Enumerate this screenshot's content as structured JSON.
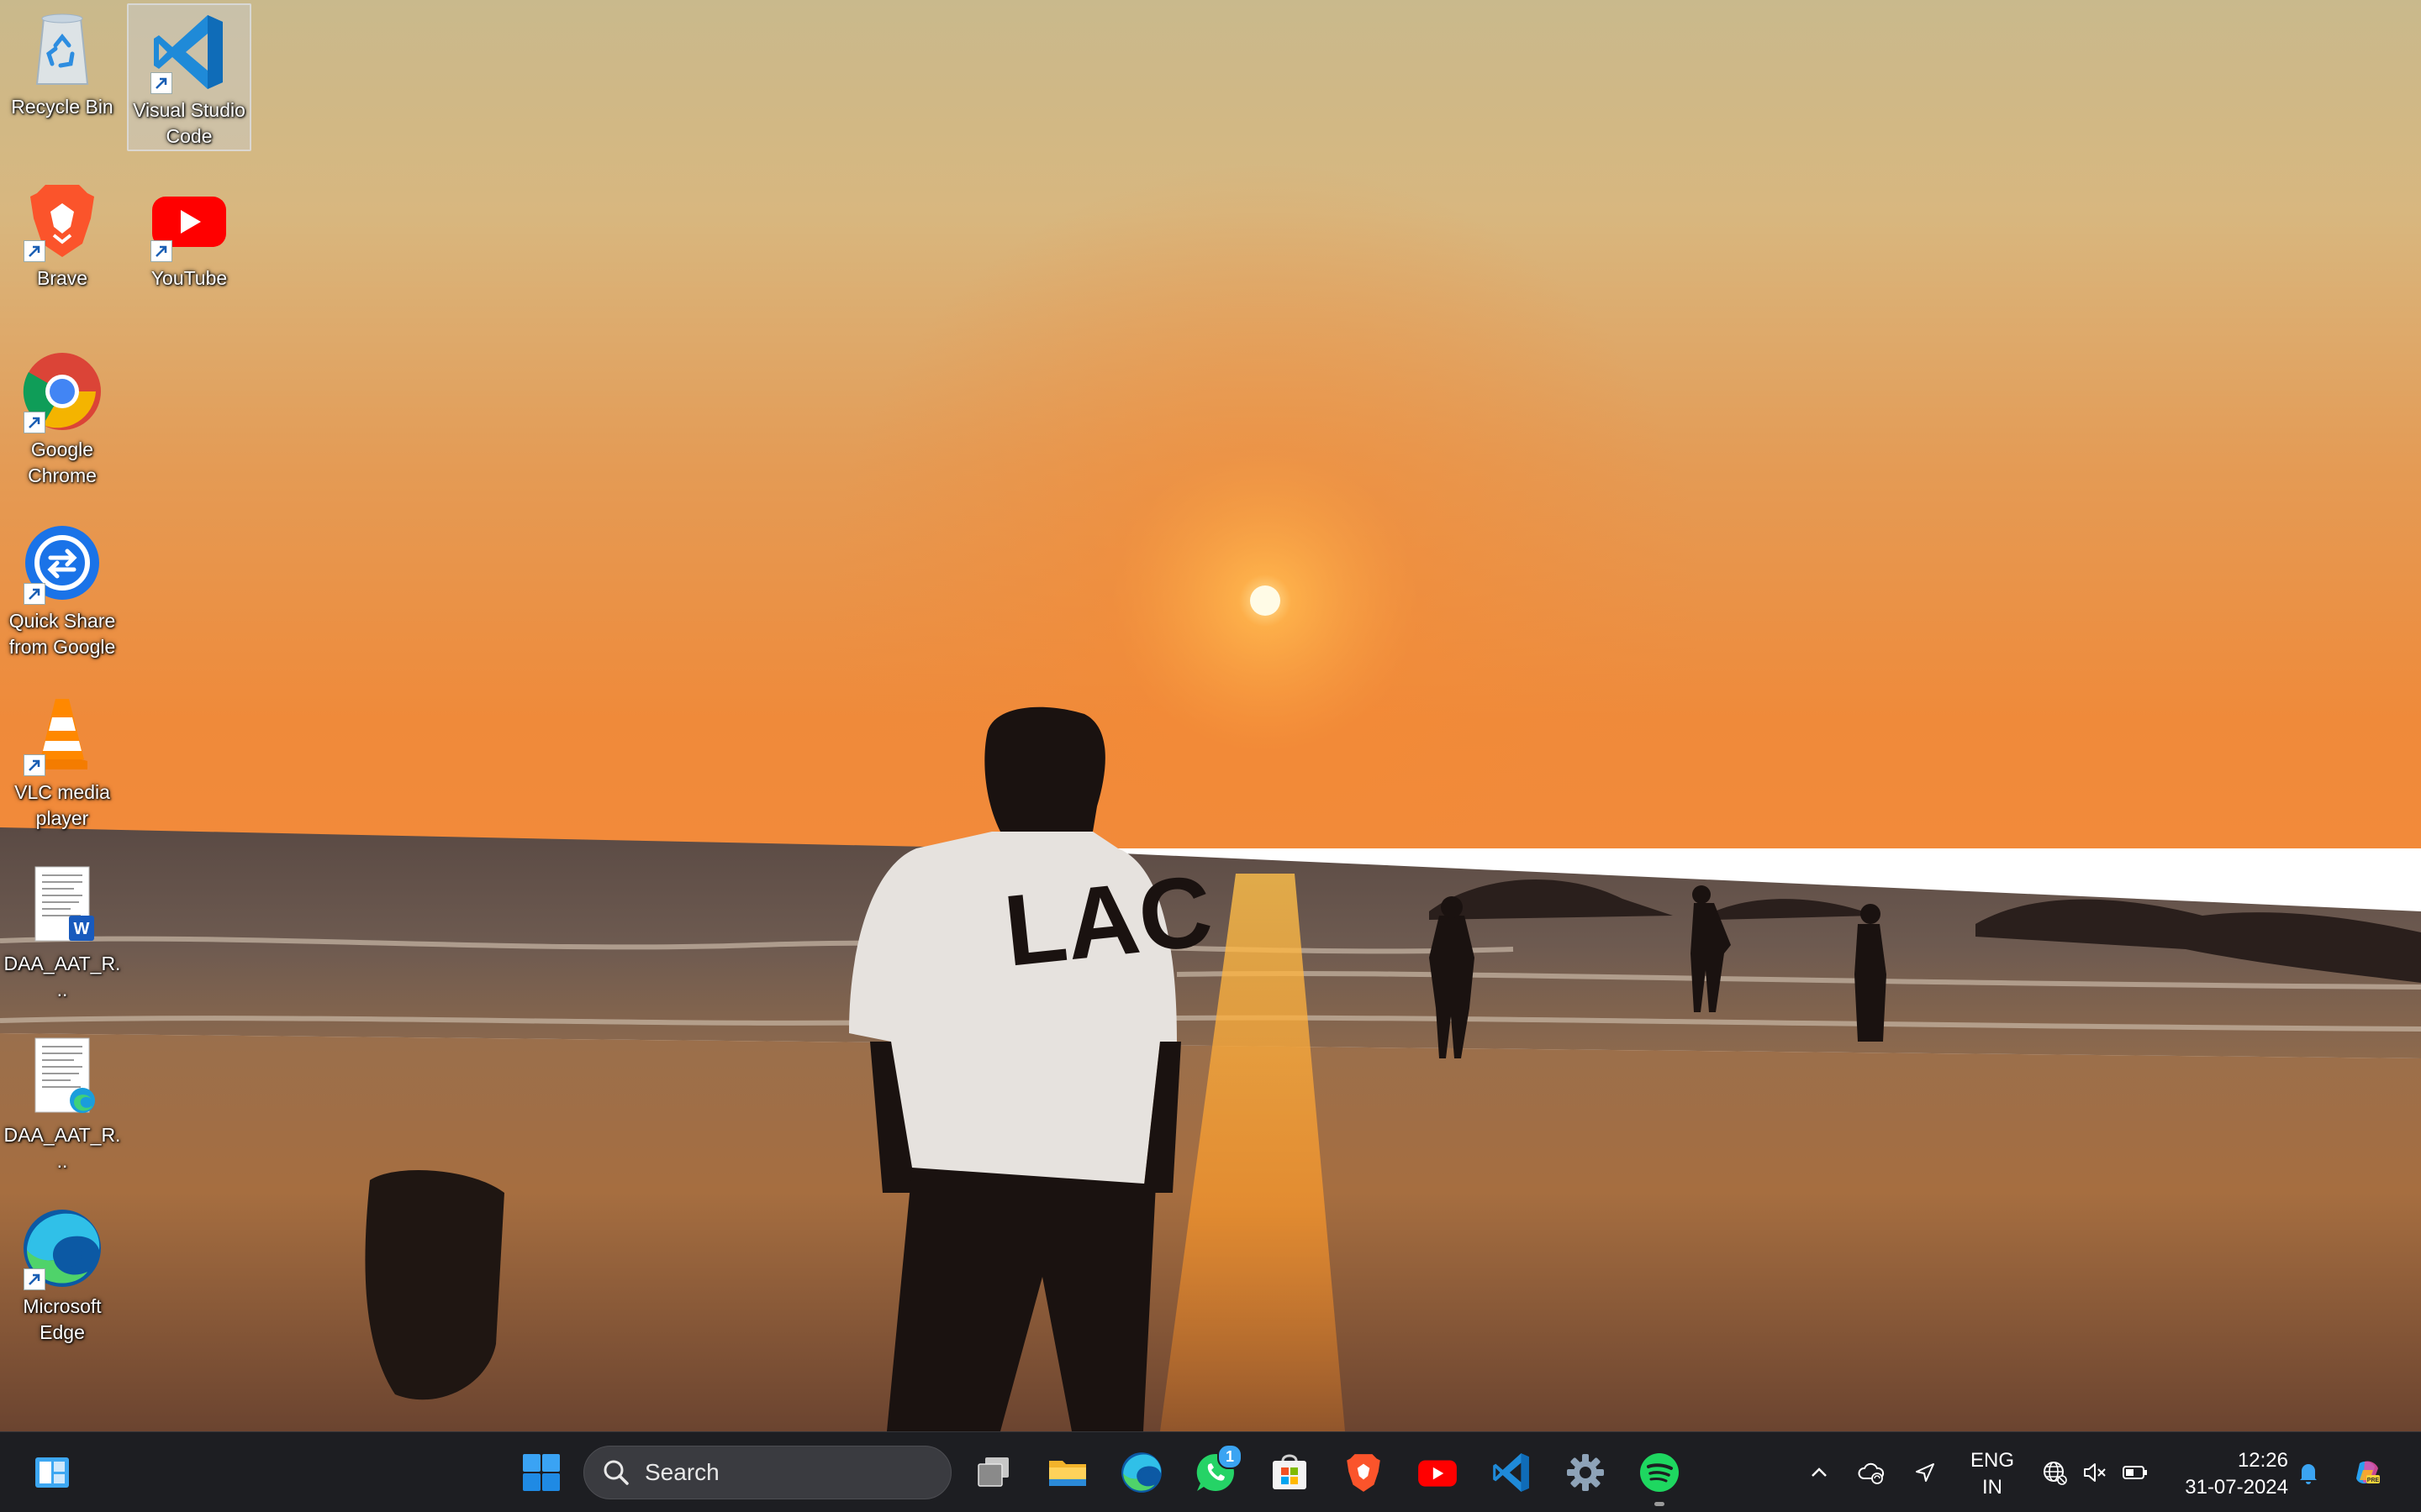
{
  "desktop": {
    "icons": [
      {
        "label": "Recycle Bin",
        "icon": "recycle-bin-icon"
      },
      {
        "label": "Visual Studio Code",
        "icon": "vscode-icon"
      },
      {
        "label": "Brave",
        "icon": "brave-icon"
      },
      {
        "label": "YouTube",
        "icon": "youtube-icon"
      },
      {
        "label": "Google Chrome",
        "icon": "chrome-icon"
      },
      {
        "label": "Quick Share from Google",
        "icon": "quick-share-icon"
      },
      {
        "label": "VLC media player",
        "icon": "vlc-icon"
      },
      {
        "label": "DAA_AAT_R...",
        "icon": "word-document-icon"
      },
      {
        "label": "DAA_AAT_R...",
        "icon": "pdf-document-icon"
      },
      {
        "label": "Microsoft Edge",
        "icon": "edge-icon"
      }
    ],
    "selected_icon": "Visual Studio Code"
  },
  "taskbar": {
    "search_placeholder": "Search",
    "pinned_apps": [
      "start",
      "task-view",
      "file-explorer",
      "edge",
      "whatsapp",
      "microsoft-store",
      "brave",
      "youtube",
      "vscode",
      "settings",
      "spotify"
    ],
    "whatsapp_badge": "1",
    "running_app": "spotify"
  },
  "tray": {
    "lang_line1": "ENG",
    "lang_line2": "IN",
    "time": "12:26",
    "date": "31-07-2024"
  },
  "colors": {
    "taskbar_bg": "#1d1e22",
    "accent_blue": "#0078d4",
    "badge_blue": "#3ba4f2",
    "spotify_green": "#1ed760"
  }
}
